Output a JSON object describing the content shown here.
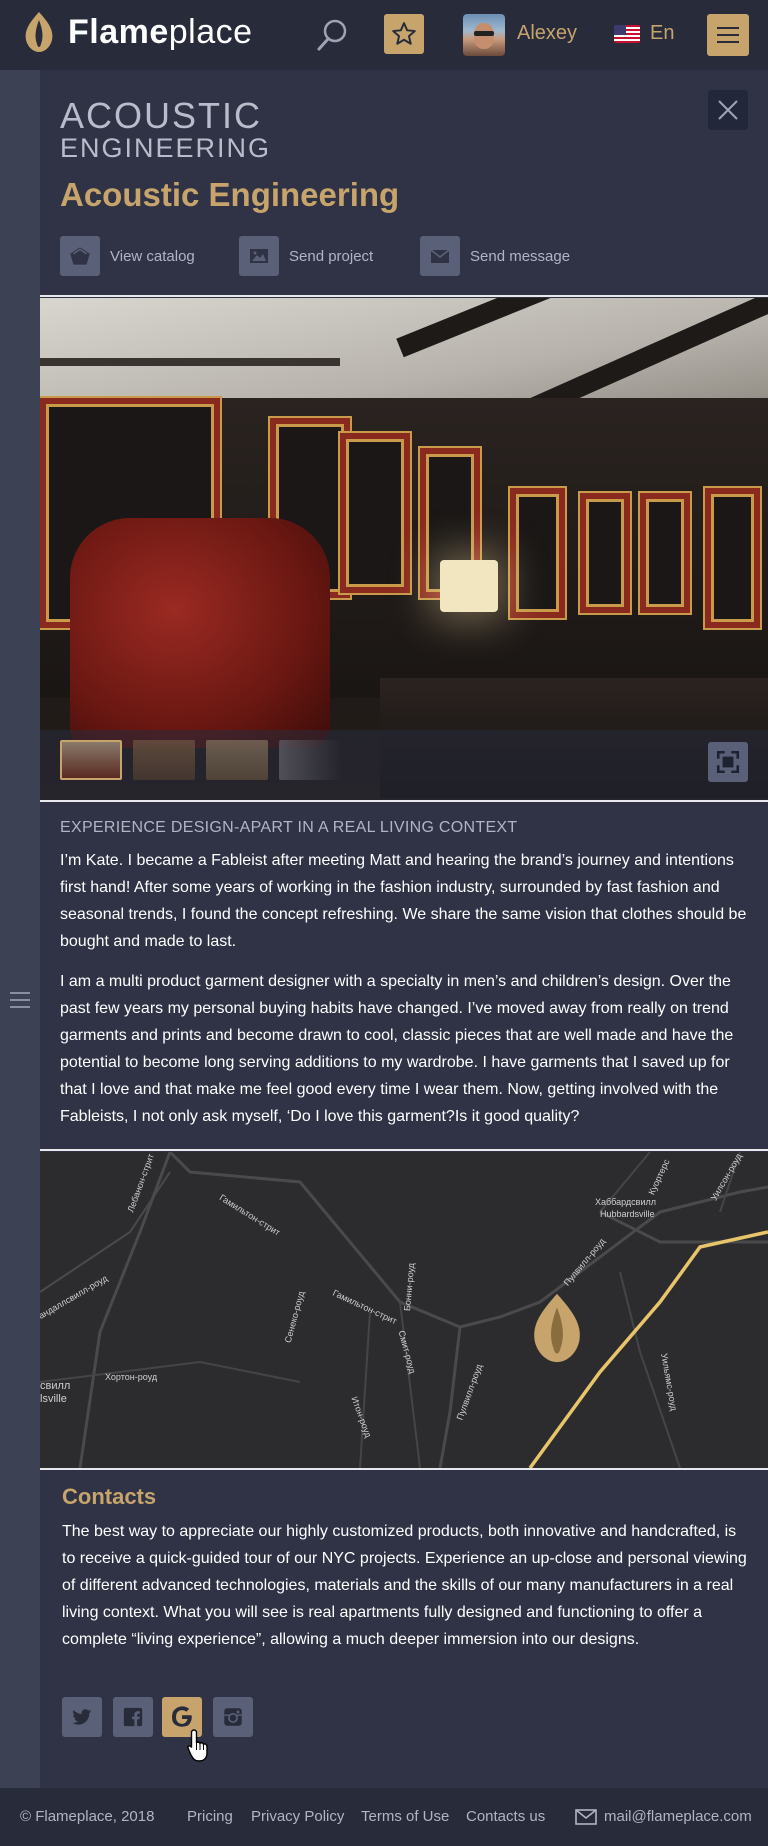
{
  "header": {
    "logo_bold": "Flame",
    "logo_light": "place",
    "user_name": "Alexey",
    "language": "En"
  },
  "brand": {
    "logo_line1": "ACOUSTIC",
    "logo_line2": "ENGINEERING",
    "title": "Acoustic Engineering"
  },
  "actions": {
    "view_catalog": "View catalog",
    "send_project": "Send project",
    "send_message": "Send message"
  },
  "description": {
    "heading": "EXPERIENCE DESIGN-APART IN A REAL LIVING CONTEXT",
    "paragraph1": "I’m Kate. I became a Fableist after meeting Matt and hearing the brand’s journey and intentions first hand! After some years of working in the fashion industry, surrounded by fast fashion and seasonal trends, I found the concept refreshing. We share the same vision that clothes should be bought and made to last.",
    "paragraph2": "I am a multi product garment designer with a specialty in men’s and children’s design. Over the past few years my personal buying habits have changed. I’ve moved away from really on trend garments and prints and become drawn to cool, classic pieces that are well made and have the potential to become long serving additions to my wardrobe. I have garments that I saved up for that I love and that make me feel good every time I wear them. Now, getting involved with the Fableists, I not only ask myself, ‘Do I love this garment?Is it good quality?"
  },
  "map": {
    "labels": [
      "Лебанон-стрит",
      "Гамильтон-стрит",
      "Гамильтон-стрит",
      "Хаббардсвилл",
      "Hubbardsville",
      "Пулвилл-роуд",
      "Пулвилл-роуд",
      "Хортон-роуд",
      "Итон-роуд",
      "Смит-роуд",
      "Сенеко-роуд",
      "Бонни-роуд",
      "Уильямс-роуд",
      "Куортерс",
      "андаллсвилл-роуд",
      "свилл",
      "lsville",
      "Уилсон-роуд"
    ]
  },
  "contacts": {
    "title": "Contacts",
    "text": "The best way to appreciate our highly customized products, both innovative and handcrafted, is to receive a quick-guided tour of our NYC projects. Experience an up-close and personal viewing of different advanced technologies, materials and the skills of our many manufacturers in a real living context. What you will see is real apartments fully designed and functioning to offer a complete “living experience”, allowing a much deeper immersion into our designs."
  },
  "footer": {
    "copyright": "© Flameplace, 2018",
    "links": [
      "Pricing",
      "Privacy Policy",
      "Terms of Use",
      "Contacts us"
    ],
    "email": "mail@flameplace.com"
  },
  "colors": {
    "accent": "#c6a46c",
    "header_bg": "#272b3a",
    "panel_bg": "#2f3345",
    "button_bg": "#5b6079"
  }
}
